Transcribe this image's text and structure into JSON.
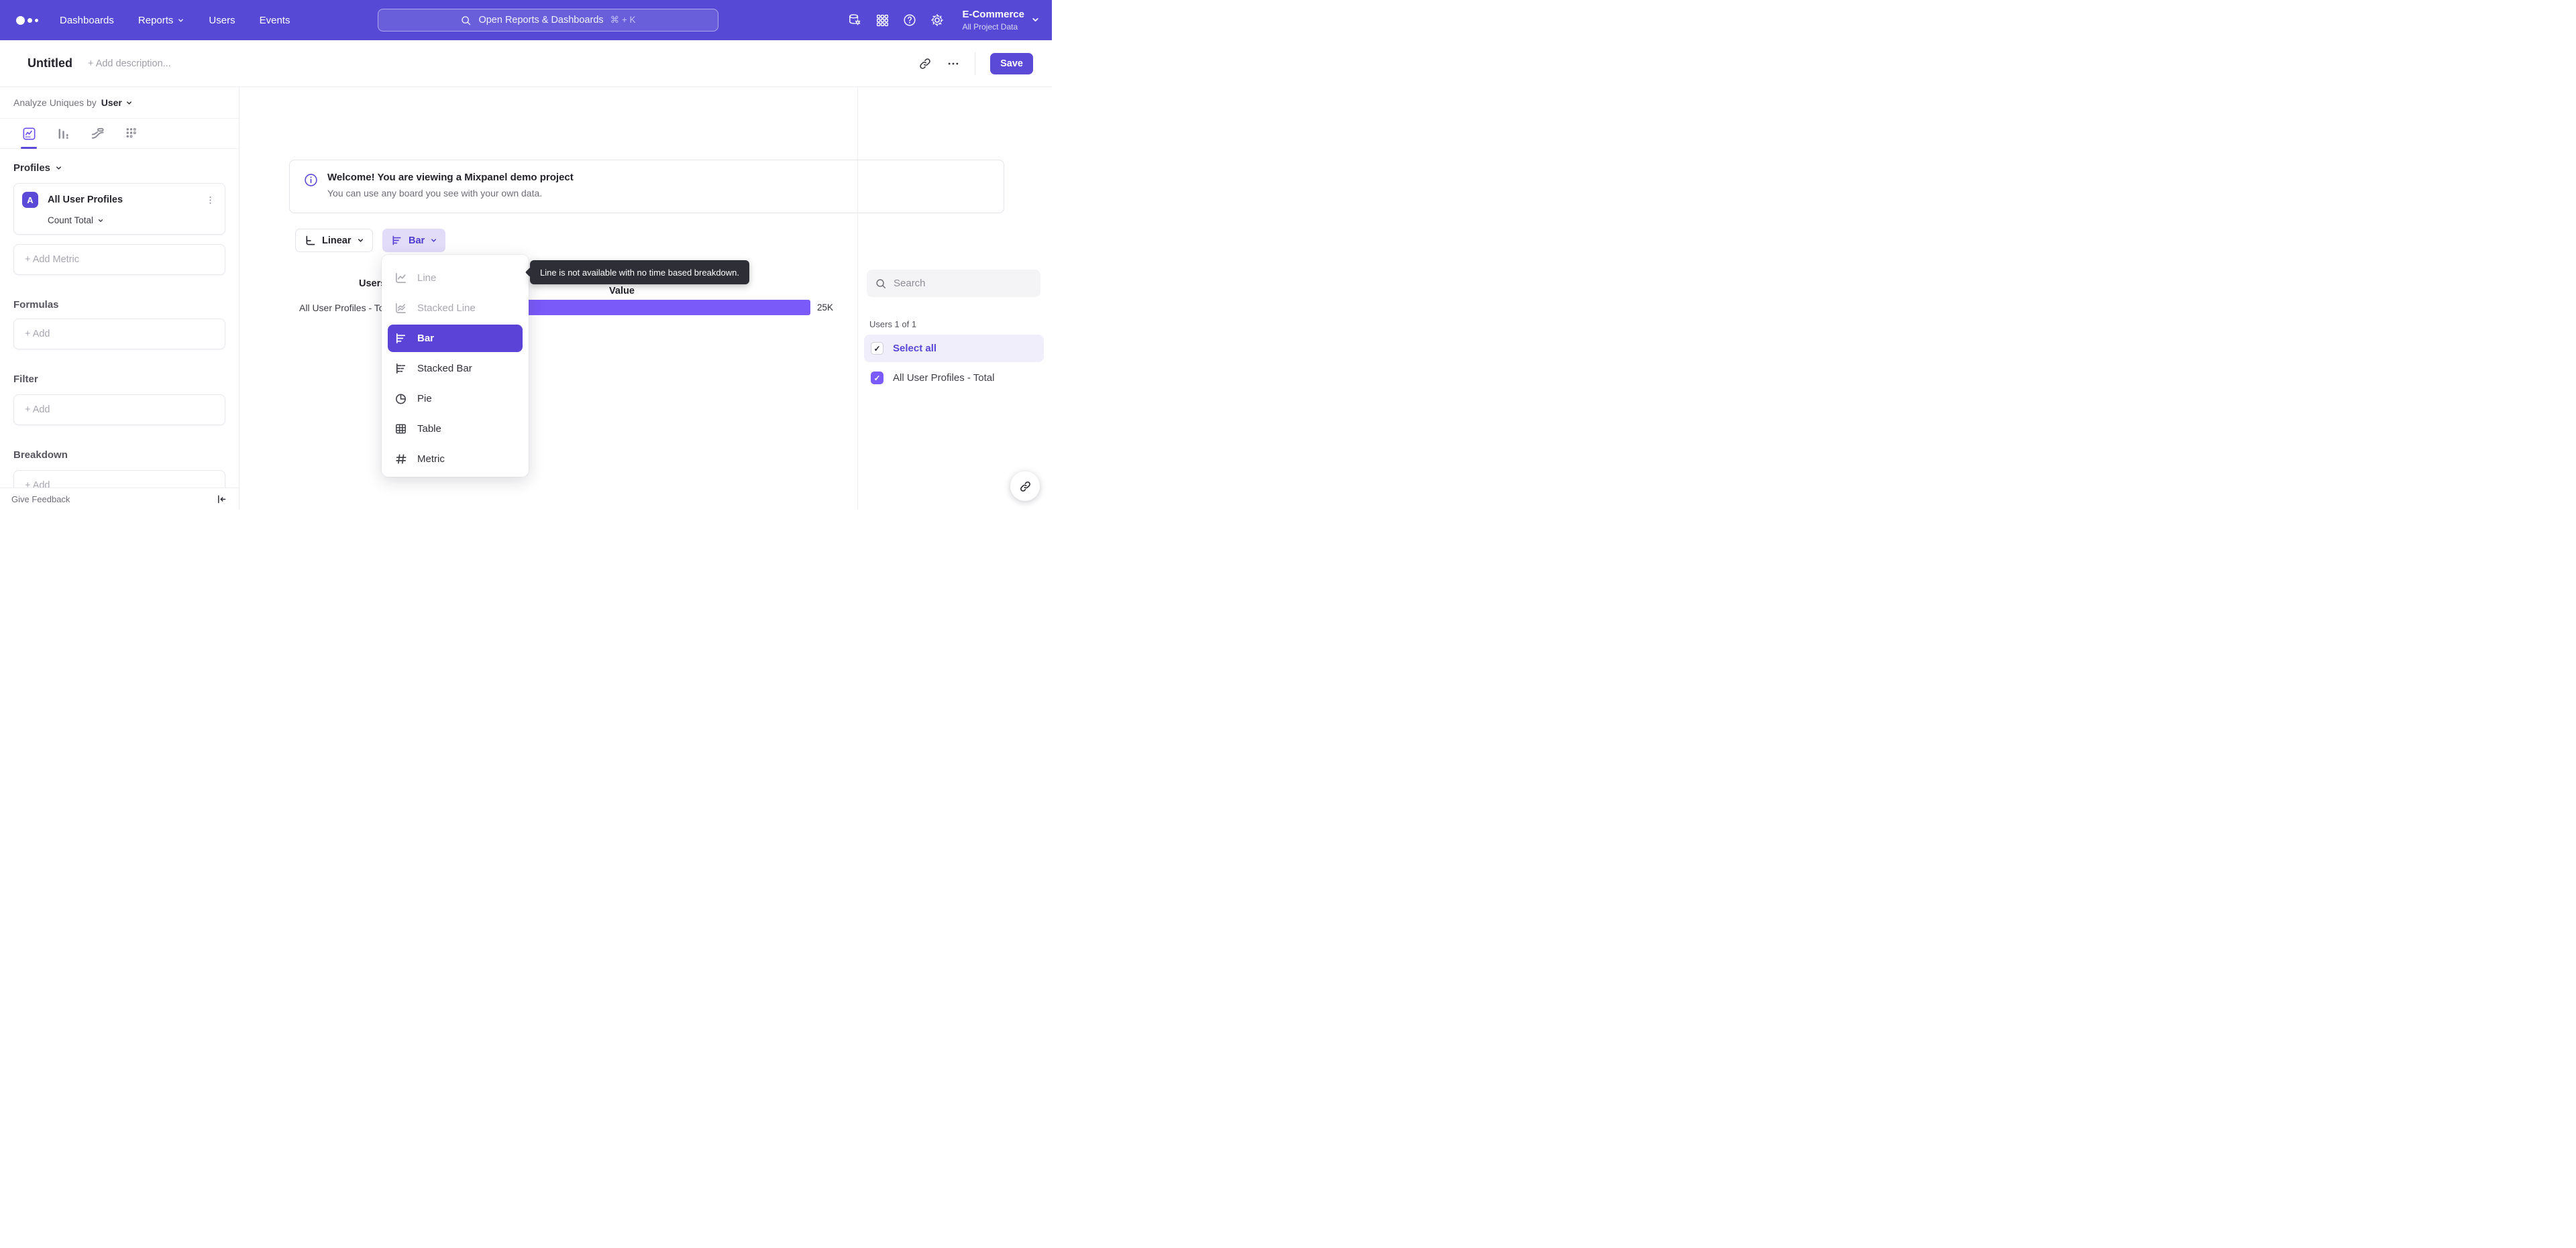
{
  "colors": {
    "nav_bg": "#5549d6",
    "accent": "#5b49d8",
    "bar_color": "#7a5af8",
    "selected_menu_bg": "#5b43d8",
    "chart_type_active_bg": "#e2dcf9",
    "tooltip_bg": "#2e2e36",
    "select_all_row_bg": "#f1eefb"
  },
  "nav": {
    "items": [
      "Dashboards",
      "Reports",
      "Users",
      "Events"
    ],
    "search_placeholder": "Open Reports & Dashboards",
    "search_shortcut": "⌘ + K",
    "project_name": "E-Commerce",
    "project_scope": "All Project Data"
  },
  "header": {
    "title": "Untitled",
    "description_placeholder": "+ Add description...",
    "save_label": "Save"
  },
  "sidebar": {
    "analyze_prefix": "Analyze Uniques by",
    "analyze_value": "User",
    "profiles_heading": "Profiles",
    "metric_badge": "A",
    "metric_name": "All User Profiles",
    "metric_aggregation": "Count Total",
    "add_metric_label": "+ Add Metric",
    "formulas_heading": "Formulas",
    "formulas_add_label": "+ Add",
    "filter_heading": "Filter",
    "filter_add_label": "+ Add",
    "breakdown_heading": "Breakdown",
    "breakdown_add_label": "+ Add",
    "feedback_label": "Give Feedback"
  },
  "banner": {
    "title": "Welcome! You are viewing a Mixpanel demo project",
    "subtitle": "You can use any board you see with your own data."
  },
  "controls": {
    "scale_label": "Linear",
    "chart_type_label": "Bar"
  },
  "menu": {
    "items": [
      {
        "label": "Line",
        "icon": "line-chart-icon",
        "state": "disabled"
      },
      {
        "label": "Stacked Line",
        "icon": "stacked-line-chart-icon",
        "state": "disabled"
      },
      {
        "label": "Bar",
        "icon": "bar-chart-icon",
        "state": "selected"
      },
      {
        "label": "Stacked Bar",
        "icon": "stacked-bar-chart-icon",
        "state": "normal"
      },
      {
        "label": "Pie",
        "icon": "pie-chart-icon",
        "state": "normal"
      },
      {
        "label": "Table",
        "icon": "table-icon",
        "state": "normal"
      },
      {
        "label": "Metric",
        "icon": "metric-hash-icon",
        "state": "normal"
      }
    ]
  },
  "tooltip": {
    "text": "Line is not available with no time based breakdown."
  },
  "chart_data": {
    "type": "bar",
    "orientation": "horizontal",
    "column_headers": [
      "Users",
      "Value"
    ],
    "categories": [
      "All User Profiles - Total"
    ],
    "series": [
      {
        "name": "All User Profiles - Total",
        "values": [
          25000
        ]
      }
    ],
    "values": [
      25000
    ],
    "value_labels": [
      "25K"
    ],
    "bar_color": "#7a5af8",
    "grid": false,
    "legend_position": "none"
  },
  "panel": {
    "search_placeholder": "Search",
    "count_label": "Users 1 of 1",
    "select_all_label": "Select all",
    "items": [
      {
        "label": "All User Profiles - Total",
        "checked": true
      }
    ]
  }
}
